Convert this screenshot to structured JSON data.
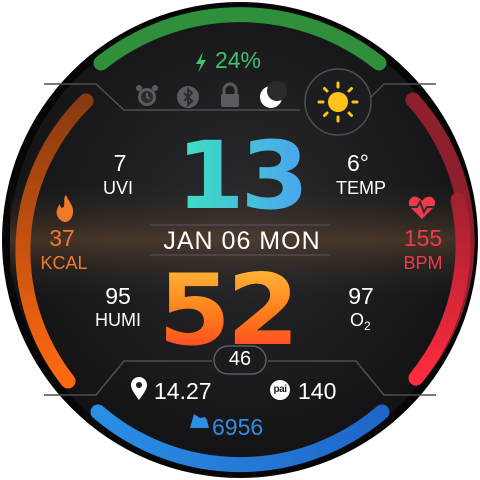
{
  "battery": {
    "value": "24%",
    "color": "#3cc36a"
  },
  "status_icons": [
    "alarm-icon",
    "bluetooth-icon",
    "lock-icon",
    "moon-icon"
  ],
  "weather": {
    "icon": "sun-icon",
    "temp": "6°",
    "temp_label": "TEMP"
  },
  "uv": {
    "value": "7",
    "label": "UVI"
  },
  "time": {
    "hours": "13",
    "minutes": "52",
    "seconds": "46"
  },
  "date": {
    "text": "JAN 06 MON"
  },
  "calories": {
    "value": "37",
    "label": "KCAL",
    "color": "#f07a2a"
  },
  "heart_rate": {
    "value": "155",
    "label": "BPM",
    "color": "#ee3a4a"
  },
  "humidity": {
    "value": "95",
    "label": "HUMI"
  },
  "oxygen": {
    "value": "97",
    "label": "O",
    "subscript": "2"
  },
  "distance": {
    "value": "14.27"
  },
  "pai": {
    "badge": "pai",
    "value": "140"
  },
  "steps": {
    "value": "6956",
    "color": "#2f8de4"
  },
  "arcs": {
    "top": "#2f8f3a",
    "left": "#f26a12",
    "right": "#ff2b3e",
    "bottom": "#2a86e0"
  }
}
